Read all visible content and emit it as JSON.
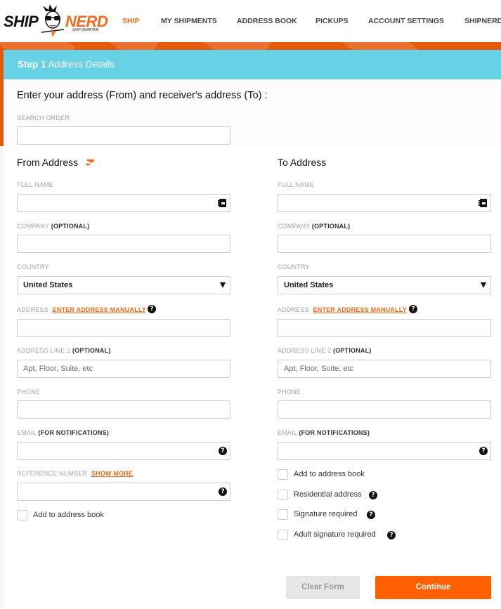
{
  "brand": {
    "logo_left": "SHIP",
    "logo_right": "NERD",
    "tagline": "SHIP SMARTER",
    "accent_color": "#f26a1b",
    "step_bar_color": "#67d1e6",
    "continue_color": "#ff5f00"
  },
  "nav": {
    "items": [
      {
        "label": "SHIP",
        "active": true
      },
      {
        "label": "MY SHIPMENTS",
        "active": false
      },
      {
        "label": "ADDRESS BOOK",
        "active": false
      },
      {
        "label": "PICKUPS",
        "active": false
      },
      {
        "label": "ACCOUNT SETTINGS",
        "active": false
      },
      {
        "label": "SHIPNERD",
        "active": false
      }
    ]
  },
  "step": {
    "number": "Step 1",
    "title": "Address Details"
  },
  "intro": "Enter your address (From) and receiver's address (To) :",
  "search_order": {
    "label": "SEARCH ORDER",
    "value": ""
  },
  "from": {
    "title": "From Address",
    "swap_icon": "swap-arrows-icon",
    "full_name": {
      "label": "FULL NAME",
      "value": ""
    },
    "company": {
      "label": "COMPANY",
      "optional": "(OPTIONAL)",
      "value": ""
    },
    "country": {
      "label": "COUNTRY",
      "value": "United States"
    },
    "address": {
      "label": "ADDRESS",
      "link": "ENTER ADDRESS MANUALLY",
      "value": ""
    },
    "address2": {
      "label": "ADDRESS LINE 2",
      "optional": "(OPTIONAL)",
      "placeholder": "Apt, Floor, Suite, etc"
    },
    "phone": {
      "label": "PHONE",
      "value": ""
    },
    "email": {
      "label": "EMAIL",
      "optional": "(FOR NOTIFICATIONS)",
      "value": ""
    },
    "reference": {
      "label": "REFERENCE NUMBER",
      "link": "SHOW MORE",
      "value": ""
    },
    "checkboxes": [
      {
        "label": "Add to address book",
        "checked": false
      }
    ]
  },
  "to": {
    "title": "To Address",
    "full_name": {
      "label": "FULL NAME",
      "value": ""
    },
    "company": {
      "label": "COMPANY",
      "optional": "(OPTIONAL)",
      "value": ""
    },
    "country": {
      "label": "COUNTRY",
      "value": "United States"
    },
    "address": {
      "label": "ADDRESS",
      "link": "ENTER ADDRESS MANUALLY",
      "value": ""
    },
    "address2": {
      "label": "ADDRESS LINE 2",
      "optional": "(OPTIONAL)",
      "placeholder": "Apt, Floor, Suite, etc"
    },
    "phone": {
      "label": "PHONE",
      "value": ""
    },
    "email": {
      "label": "EMAIL",
      "optional": "(FOR NOTIFICATIONS)",
      "value": ""
    },
    "checkboxes": [
      {
        "label": "Add to address book",
        "checked": false,
        "help": false
      },
      {
        "label": "Residential address",
        "checked": false,
        "help": true
      },
      {
        "label": "Signature required",
        "checked": false,
        "help": true
      },
      {
        "label": "Adult signature required",
        "checked": false,
        "help": true
      }
    ]
  },
  "actions": {
    "clear_label": "Clear Form",
    "continue_label": "Continue"
  },
  "help_glyph": "?"
}
